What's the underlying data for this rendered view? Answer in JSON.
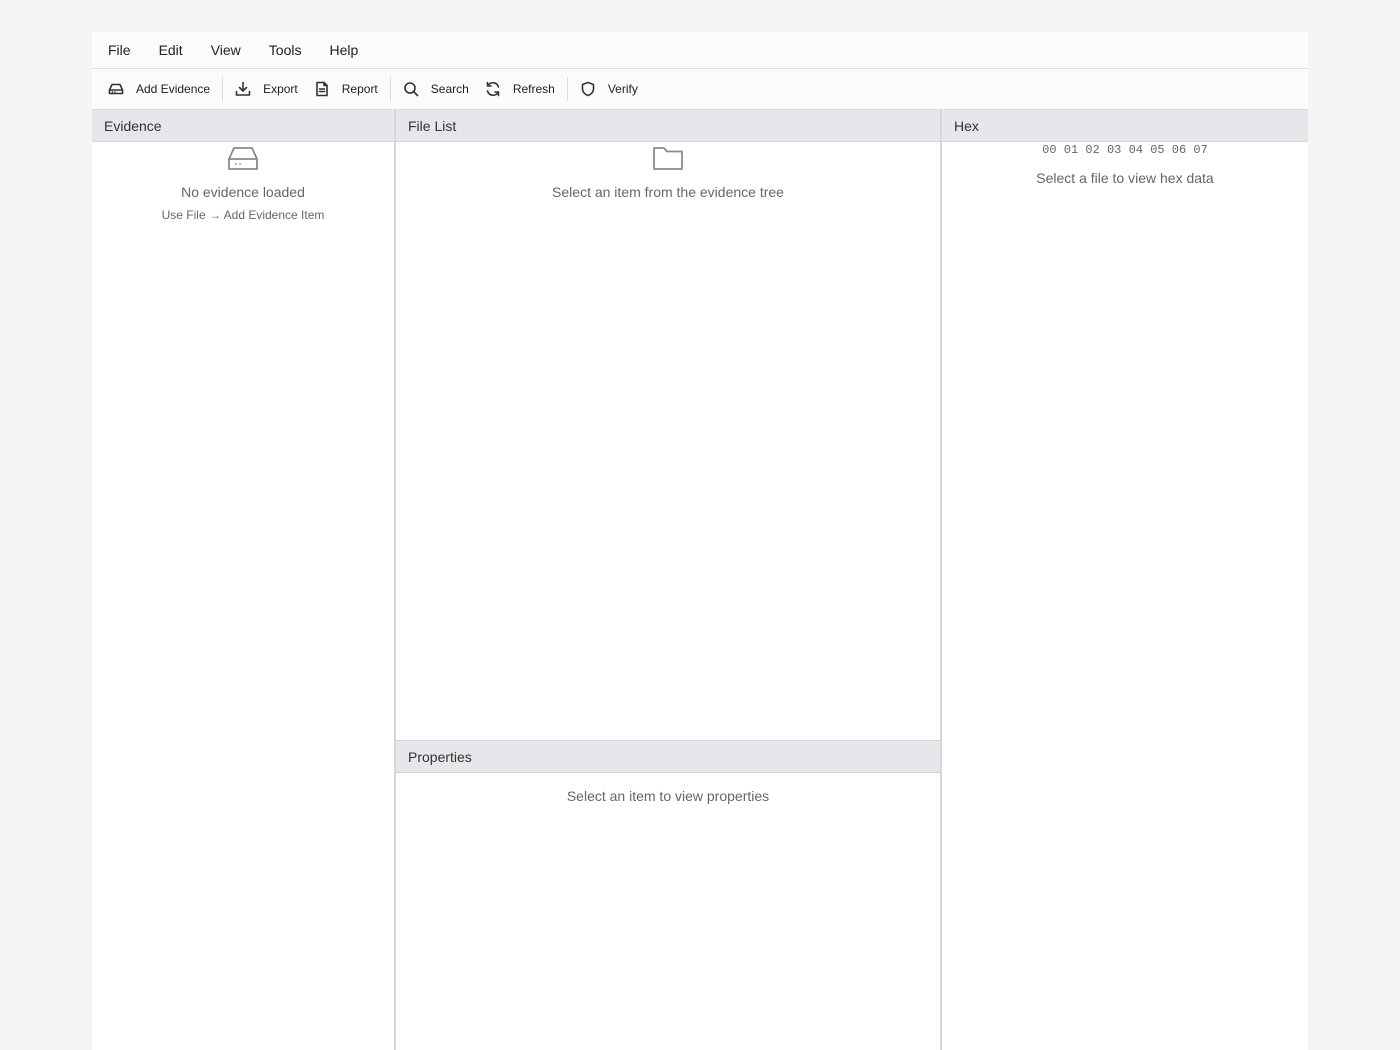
{
  "menu": {
    "items": [
      "File",
      "Edit",
      "View",
      "Tools",
      "Help"
    ]
  },
  "toolbar": {
    "add_evidence": "Add Evidence",
    "export": "Export",
    "report": "Report",
    "search": "Search",
    "refresh": "Refresh",
    "verify": "Verify",
    "icons": [
      "hard-drive-icon",
      "download-icon",
      "document-icon",
      "search-icon",
      "refresh-icon",
      "shield-icon"
    ]
  },
  "evidence": {
    "title": "Evidence",
    "empty_title": "No evidence loaded",
    "empty_hint": "Use File → Add Evidence Item",
    "icon": "hard-drive-icon"
  },
  "file_list": {
    "title": "File List",
    "empty_title": "Select an item from the evidence tree",
    "icon": "folder-icon"
  },
  "properties": {
    "title": "Properties",
    "empty_title": "Select an item to view properties"
  },
  "hex": {
    "title": "Hex",
    "columns": "00 01 02 03 04 05 06 07",
    "empty_title": "Select a file to view hex data"
  },
  "colors": {
    "header_bg": "#e6e7ea",
    "bar_bg": "#fafbfc",
    "muted_text": "#666666"
  }
}
